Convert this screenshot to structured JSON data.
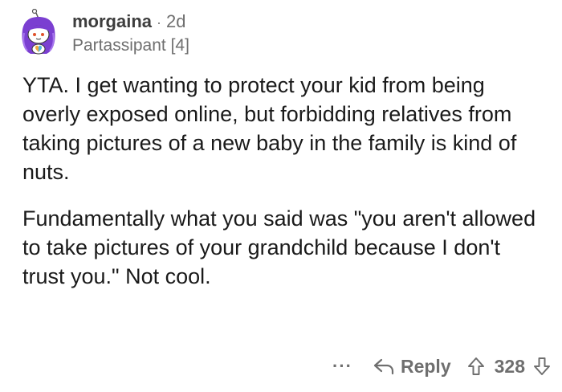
{
  "comment": {
    "author": "morgaina",
    "separator": "·",
    "age": "2d",
    "flair": "Partassipant [4]",
    "paragraphs": [
      "YTA. I get wanting to protect your kid from being overly exposed online, but forbidding relatives from taking pictures of a new baby in the family is kind of nuts.",
      "Fundamentally what you said was \"you aren't allowed to take pictures of your grandchild because I don't trust you.\" Not cool."
    ]
  },
  "actions": {
    "more_label": "···",
    "reply_label": "Reply",
    "score": "328"
  },
  "icons": {
    "avatar": "snoo-avatar-purple-hair",
    "reply": "reply-arrow-icon",
    "upvote": "upvote-arrow-icon",
    "downvote": "downvote-arrow-icon"
  },
  "colors": {
    "text": "#1a1a1a",
    "muted": "#6f6f6f",
    "avatar_hair": "#7b3fd1"
  }
}
